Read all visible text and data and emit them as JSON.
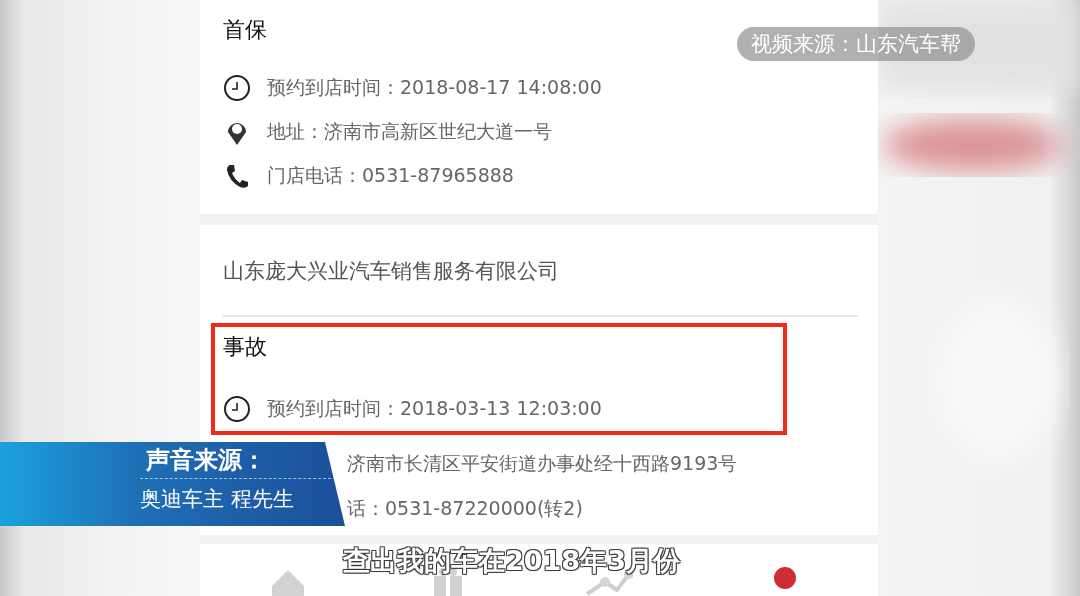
{
  "source_badge": "视频来源：山东汽车帮",
  "cards": [
    {
      "title": "首保",
      "highlighted": false,
      "rows": [
        {
          "kind": "time",
          "text": "预约到店时间：2018-08-17 14:08:00"
        },
        {
          "kind": "address",
          "text": "地址：济南市高新区世纪大道一号"
        },
        {
          "kind": "phone",
          "text": "门店电话：0531-87965888"
        }
      ]
    },
    {
      "company": "山东庞大兴业汽车销售服务有限公司",
      "title": "事故",
      "highlighted": true,
      "rows": [
        {
          "kind": "time",
          "text": "预约到店时间：2018-03-13 12:03:00"
        },
        {
          "kind": "plain",
          "text": "济南市长清区平安街道办事处经十西路9193号"
        },
        {
          "kind": "plain",
          "text": "话：0531-87220000(转2)"
        }
      ]
    }
  ],
  "nav": [
    {
      "kind": "home"
    },
    {
      "kind": "gift"
    },
    {
      "kind": "chart"
    },
    {
      "kind": "dot"
    }
  ],
  "banner": {
    "heading": "声音来源：",
    "name": "奥迪车主 程先生"
  },
  "subtitle": "查出我的车在2018年3月份"
}
